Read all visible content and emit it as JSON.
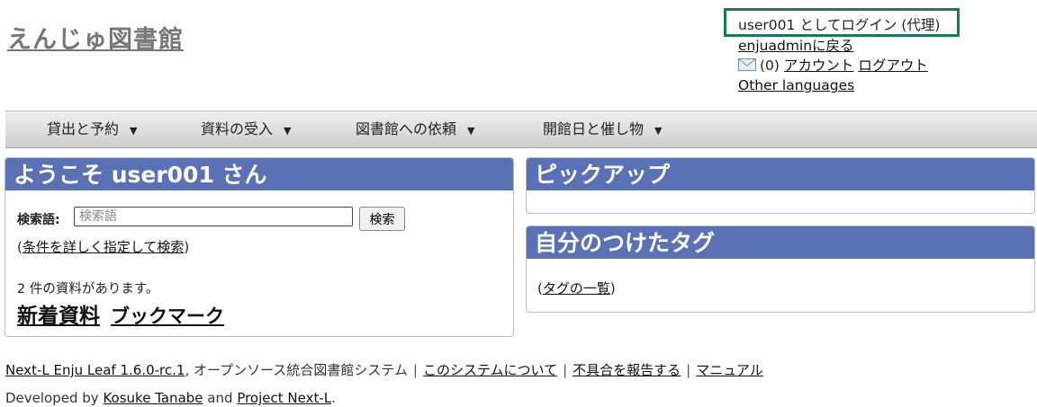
{
  "site": {
    "title": "えんじゅ図書館"
  },
  "user": {
    "login_as": "user001 としてログイン (代理)",
    "back_link": "enjuadminに戻る",
    "mail_count": "(0)",
    "account_link": "アカウント",
    "logout_link": "ログアウト",
    "languages_link": "Other languages"
  },
  "menu": {
    "items": [
      {
        "label": "貸出と予約"
      },
      {
        "label": "資料の受入"
      },
      {
        "label": "図書館への依頼"
      },
      {
        "label": "開館日と催し物"
      }
    ],
    "caret": "▼"
  },
  "welcome": {
    "title": "ようこそ user001 さん",
    "search_label": "検索語:",
    "search_placeholder": "検索語",
    "search_button": "検索",
    "advanced_prefix": "(",
    "advanced_link": "条件を詳しく指定して検索",
    "advanced_suffix": ")",
    "count_text": "2 件の資料があります。",
    "new_items_link": "新着資料",
    "bookmark_link": "ブックマーク"
  },
  "pickup": {
    "title": "ピックアップ"
  },
  "tags": {
    "title": "自分のつけたタグ",
    "prefix": "(",
    "list_link": "タグの一覧",
    "suffix": ")"
  },
  "footer": {
    "product_link": "Next-L Enju Leaf 1.6.0-rc.1",
    "product_desc": ", オープンソース統合図書館システム",
    "separator": "|",
    "about_link": "このシステムについて",
    "report_link": "不具合を報告する",
    "manual_link": "マニュアル",
    "developed_by": "Developed by",
    "author_link": "Kosuke Tanabe",
    "and_text": "and",
    "project_link": "Project Next-L",
    "period": "."
  }
}
